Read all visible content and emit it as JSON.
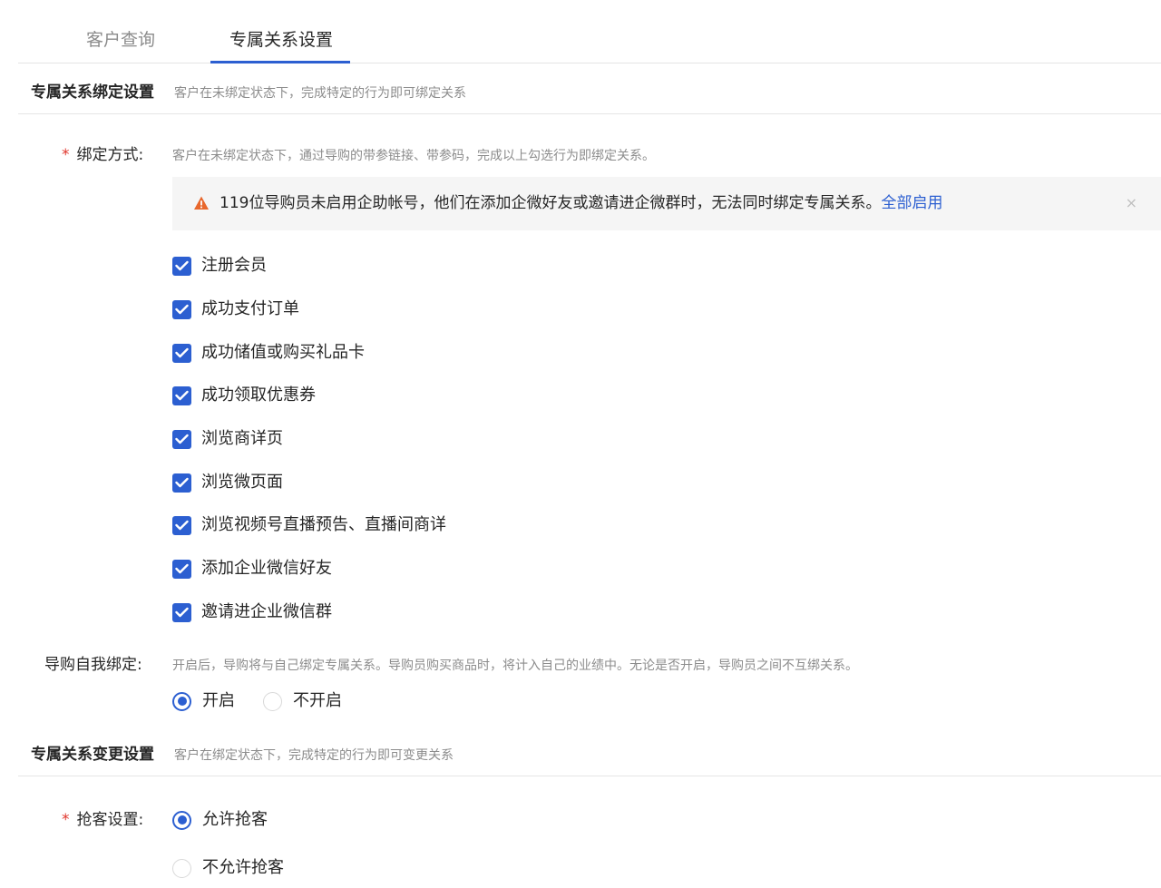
{
  "tabs": [
    {
      "label": "客户查询",
      "active": false
    },
    {
      "label": "专属关系设置",
      "active": true
    }
  ],
  "binding_section": {
    "title": "专属关系绑定设置",
    "description": "客户在未绑定状态下，完成特定的行为即可绑定关系"
  },
  "binding_method": {
    "required_mark": "*",
    "label": "绑定方式:",
    "hint": "客户在未绑定状态下，通过导购的带参链接、带参码，完成以上勾选行为即绑定关系。",
    "alert": {
      "icon": "warning-triangle-icon",
      "text": "119位导购员未启用企助帐号，他们在添加企微好友或邀请进企微群时，无法同时绑定专属关系。",
      "link": "全部启用",
      "close": "×"
    },
    "options": [
      {
        "label": "注册会员",
        "checked": true
      },
      {
        "label": "成功支付订单",
        "checked": true
      },
      {
        "label": "成功储值或购买礼品卡",
        "checked": true
      },
      {
        "label": "成功领取优惠券",
        "checked": true
      },
      {
        "label": "浏览商详页",
        "checked": true
      },
      {
        "label": "浏览微页面",
        "checked": true
      },
      {
        "label": "浏览视频号直播预告、直播间商详",
        "checked": true
      },
      {
        "label": "添加企业微信好友",
        "checked": true
      },
      {
        "label": "邀请进企业微信群",
        "checked": true
      }
    ]
  },
  "self_binding": {
    "label": "导购自我绑定:",
    "hint": "开启后，导购将与自己绑定专属关系。导购员购买商品时，将计入自己的业绩中。无论是否开启，导购员之间不互绑关系。",
    "options": [
      {
        "label": "开启",
        "selected": true
      },
      {
        "label": "不开启",
        "selected": false
      }
    ]
  },
  "change_section": {
    "title": "专属关系变更设置",
    "description": "客户在绑定状态下，完成特定的行为即可变更关系"
  },
  "grab_setting": {
    "required_mark": "*",
    "label": "抢客设置:",
    "options": [
      {
        "label": "允许抢客",
        "selected": true
      },
      {
        "label": "不允许抢客",
        "selected": false
      }
    ]
  },
  "colors": {
    "primary": "#2c5fd1",
    "warning": "#e8672c",
    "required": "#e0352b"
  }
}
